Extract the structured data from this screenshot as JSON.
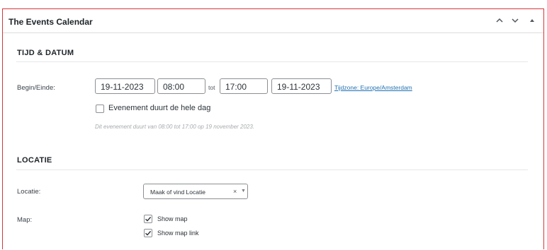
{
  "metabox": {
    "title": "The Events Calendar",
    "controls": [
      "chevron-up-icon",
      "chevron-down-icon",
      "toggle-arrow-icon"
    ]
  },
  "datetime": {
    "section_title": "TIJD & DATUM",
    "label": "Begin/Einde:",
    "start_date": "19-11-2023",
    "start_time": "08:00",
    "separator": "tot",
    "end_time": "17:00",
    "end_date": "19-11-2023",
    "timezone_link": "Tijdzone: Europe/Amsterdam",
    "all_day_label": "Evenement duurt de hele dag",
    "all_day_checked": false,
    "summary": "Dit evenement duurt van 08:00 tot 17:00 op 19 november 2023."
  },
  "location": {
    "section_title": "LOCATIE",
    "venue_label": "Locatie:",
    "venue_select": "Maak of vind Locatie",
    "venue_clear": "×",
    "venue_arrow": "▼",
    "map_label": "Map:",
    "show_map_label": "Show map",
    "show_map_checked": true,
    "show_map_link_label": "Show map link",
    "show_map_link_checked": true
  },
  "colors": {
    "border_accent": "#d63638",
    "link": "#2271b1"
  }
}
